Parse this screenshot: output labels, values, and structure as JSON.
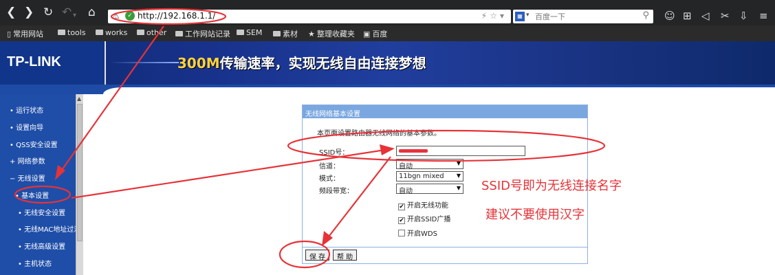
{
  "browser": {
    "url": "http://192.168.1.1/",
    "search_placeholder": "百度一下"
  },
  "bookmarks": [
    "常用网站",
    "tools",
    "works",
    "other",
    "工作网站记录",
    "SEM",
    "素材",
    "整理收藏夹",
    "百度"
  ],
  "banner": {
    "logo": "TP-LINK",
    "slogan_number": "300M",
    "slogan_text": "传输速率，实现无线自由连接梦想"
  },
  "sidebar": {
    "items": [
      {
        "label": "运行状态",
        "bullet": "•"
      },
      {
        "label": "设置向导",
        "bullet": "•"
      },
      {
        "label": "QSS安全设置",
        "bullet": "•"
      },
      {
        "label": "网络参数",
        "bullet": "+"
      },
      {
        "label": "无线设置",
        "bullet": "−"
      },
      {
        "label": "基本设置",
        "bullet": "•"
      },
      {
        "label": "无线安全设置",
        "bullet": "•"
      },
      {
        "label": "无线MAC地址过滤",
        "bullet": "•"
      },
      {
        "label": "无线高级设置",
        "bullet": "•"
      },
      {
        "label": "主机状态",
        "bullet": "•"
      }
    ]
  },
  "panel": {
    "title": "无线网络基本设置",
    "description": "本页面设置路由器无线网络的基本参数。",
    "fields": {
      "ssid_label": "SSID号：",
      "channel_label": "信道：",
      "channel_value": "自动",
      "mode_label": "模式：",
      "mode_value": "11bgn mixed",
      "bandwidth_label": "频段带宽：",
      "bandwidth_value": "自动"
    },
    "checkboxes": [
      {
        "label": "开启无线功能",
        "checked": true
      },
      {
        "label": "开启SSID广播",
        "checked": true
      },
      {
        "label": "开启WDS",
        "checked": false
      }
    ],
    "buttons": {
      "save": "保 存",
      "help": "帮 助"
    }
  },
  "annotations": {
    "line1": "SSID号即为无线连接名字",
    "line2": "建议不要使用汉字",
    "color": "#e63338"
  }
}
